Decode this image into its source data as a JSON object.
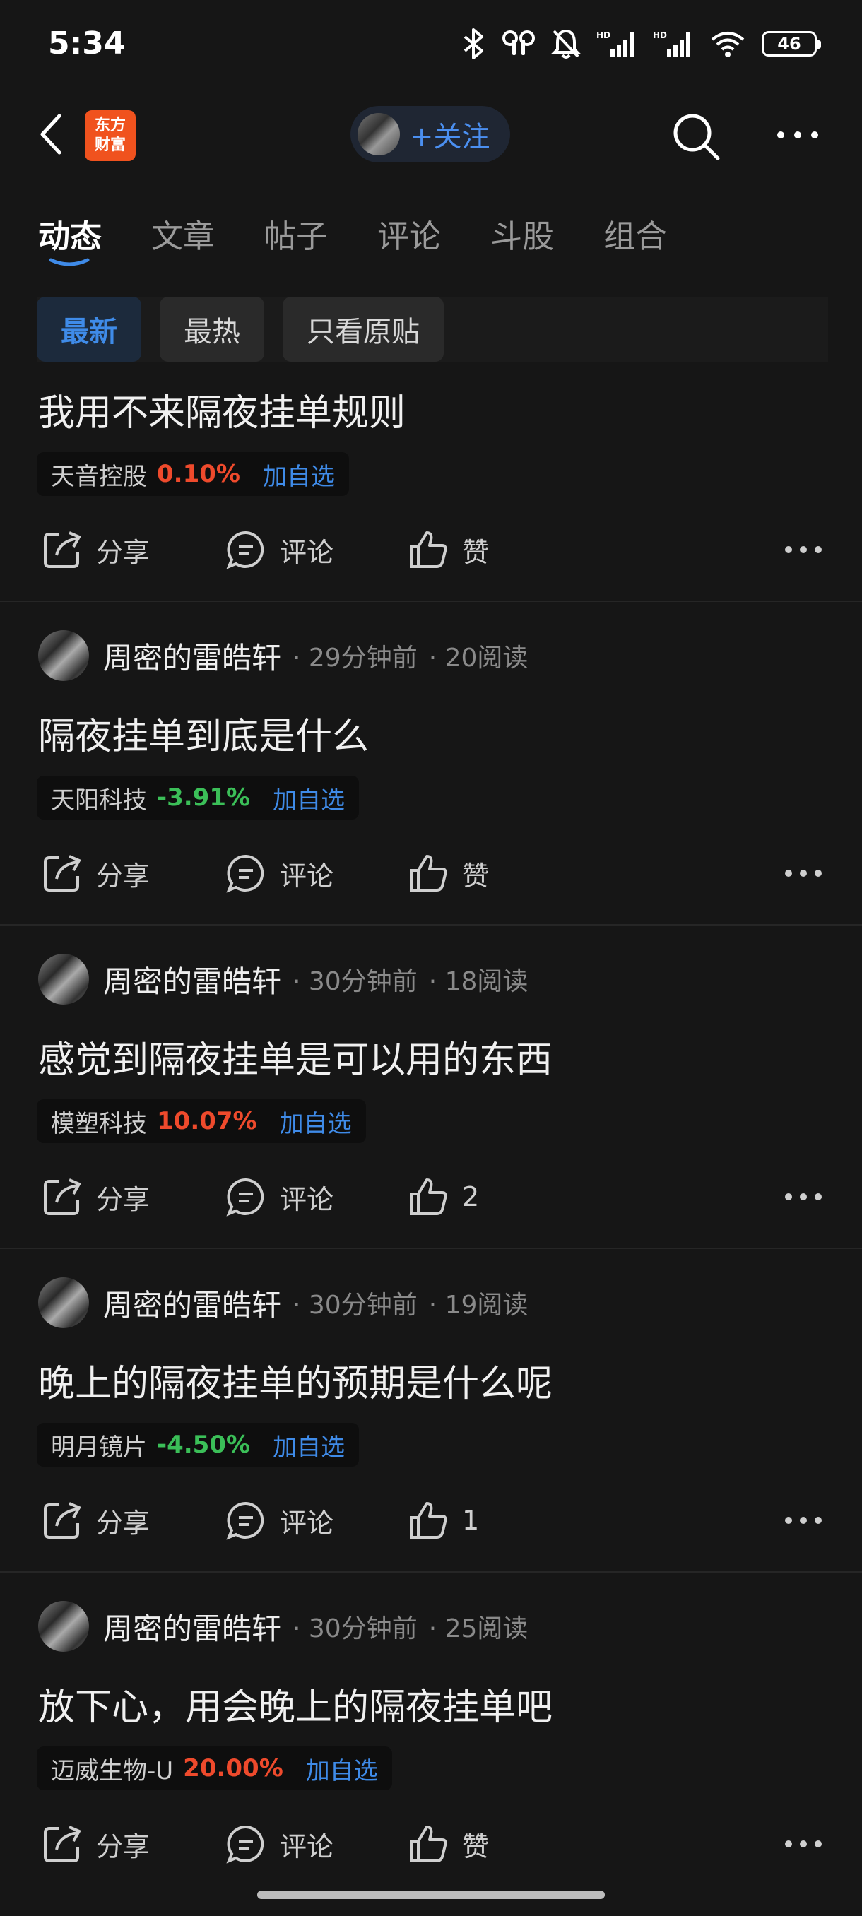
{
  "status_bar": {
    "time": "5:34",
    "battery": "46"
  },
  "top_bar": {
    "logo_line1": "东方",
    "logo_line2": "财富",
    "follow_label": "+关注"
  },
  "tabs": [
    "动态",
    "文章",
    "帖子",
    "评论",
    "斗股",
    "组合"
  ],
  "filters": [
    "最新",
    "最热",
    "只看原贴"
  ],
  "actions": {
    "share": "分享",
    "comment": "评论",
    "like_default": "赞"
  },
  "posts": [
    {
      "title": "我用不来隔夜挂单规则",
      "stock": {
        "name": "天音控股",
        "change": "0.10%",
        "add": "加自选"
      },
      "likes": "赞"
    },
    {
      "author": "周密的雷皓轩",
      "time": "· 29分钟前",
      "reads": "· 20阅读",
      "title": "隔夜挂单到底是什么",
      "stock": {
        "name": "天阳科技",
        "change": "-3.91%",
        "add": "加自选"
      },
      "likes": "赞"
    },
    {
      "author": "周密的雷皓轩",
      "time": "· 30分钟前",
      "reads": "· 18阅读",
      "title": "感觉到隔夜挂单是可以用的东西",
      "stock": {
        "name": "模塑科技",
        "change": "10.07%",
        "add": "加自选"
      },
      "likes": "2"
    },
    {
      "author": "周密的雷皓轩",
      "time": "· 30分钟前",
      "reads": "· 19阅读",
      "title": "晚上的隔夜挂单的预期是什么呢",
      "stock": {
        "name": "明月镜片",
        "change": "-4.50%",
        "add": "加自选"
      },
      "likes": "1"
    },
    {
      "author": "周密的雷皓轩",
      "time": "· 30分钟前",
      "reads": "· 25阅读",
      "title": "放下心，用会晚上的隔夜挂单吧",
      "stock": {
        "name": "迈威生物-U",
        "change": "20.00%",
        "add": "加自选"
      },
      "likes": "赞"
    }
  ]
}
